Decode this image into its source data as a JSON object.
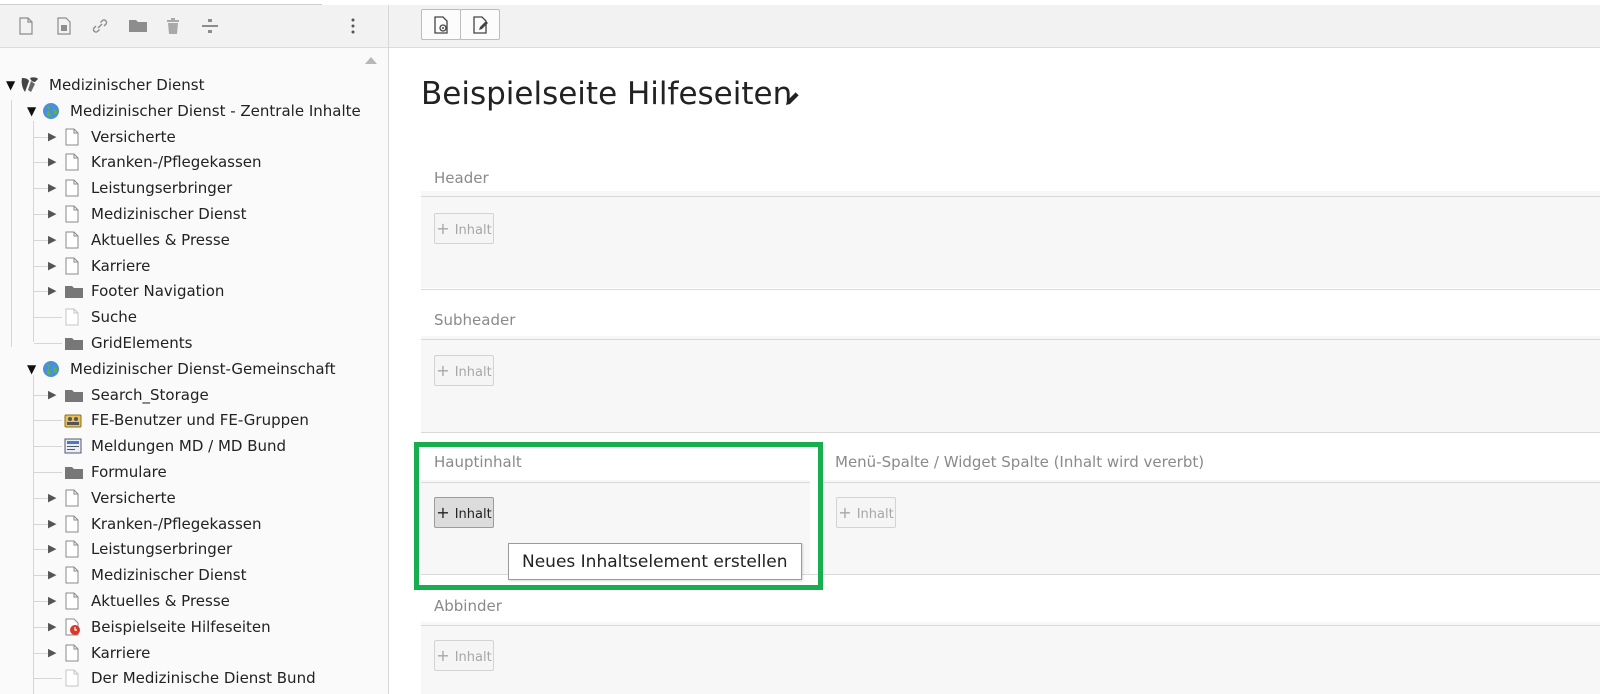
{
  "sidebar": {
    "toolbar": {
      "icons": [
        "new-page-icon",
        "new-page-inside-icon",
        "link-icon",
        "folder-icon",
        "trash-icon",
        "divider-icon",
        "more-icon"
      ]
    },
    "tree": [
      {
        "label": "Medizinischer Dienst",
        "level": 0,
        "icon": "typo3-logo",
        "expanded": true
      },
      {
        "label": "Medizinischer Dienst - Zentrale Inhalte",
        "level": 1,
        "icon": "globe",
        "expanded": true
      },
      {
        "label": "Versicherte",
        "level": 2,
        "icon": "page",
        "hasChildren": true
      },
      {
        "label": "Kranken-/Pflegekassen",
        "level": 2,
        "icon": "page",
        "hasChildren": true
      },
      {
        "label": "Leistungserbringer",
        "level": 2,
        "icon": "page",
        "hasChildren": true
      },
      {
        "label": "Medizinischer Dienst",
        "level": 2,
        "icon": "page",
        "hasChildren": true
      },
      {
        "label": "Aktuelles & Presse",
        "level": 2,
        "icon": "page",
        "hasChildren": true
      },
      {
        "label": "Karriere",
        "level": 2,
        "icon": "page",
        "hasChildren": true
      },
      {
        "label": "Footer Navigation",
        "level": 2,
        "icon": "folder",
        "hasChildren": true
      },
      {
        "label": "Suche",
        "level": 2,
        "icon": "page-light",
        "hasChildren": false
      },
      {
        "label": "GridElements",
        "level": 2,
        "icon": "folder",
        "hasChildren": false
      },
      {
        "label": "Medizinischer Dienst-Gemeinschaft",
        "level": 1,
        "icon": "globe",
        "expanded": true
      },
      {
        "label": "Search_Storage",
        "level": 2,
        "icon": "folder",
        "hasChildren": true
      },
      {
        "label": "FE-Benutzer und FE-Gruppen",
        "level": 2,
        "icon": "users",
        "hasChildren": false
      },
      {
        "label": "Meldungen MD / MD Bund",
        "level": 2,
        "icon": "news",
        "hasChildren": false
      },
      {
        "label": "Formulare",
        "level": 2,
        "icon": "folder",
        "hasChildren": false
      },
      {
        "label": "Versicherte",
        "level": 2,
        "icon": "page",
        "hasChildren": true
      },
      {
        "label": "Kranken-/Pflegekassen",
        "level": 2,
        "icon": "page",
        "hasChildren": true
      },
      {
        "label": "Leistungserbringer",
        "level": 2,
        "icon": "page",
        "hasChildren": true
      },
      {
        "label": "Medizinischer Dienst",
        "level": 2,
        "icon": "page",
        "hasChildren": true
      },
      {
        "label": "Aktuelles & Presse",
        "level": 2,
        "icon": "page",
        "hasChildren": true
      },
      {
        "label": "Beispielseite Hilfeseiten",
        "level": 2,
        "icon": "page-timer",
        "hasChildren": true
      },
      {
        "label": "Karriere",
        "level": 2,
        "icon": "page",
        "hasChildren": true
      },
      {
        "label": "Der Medizinische Dienst Bund",
        "level": 2,
        "icon": "page-light",
        "hasChildren": false
      }
    ]
  },
  "main": {
    "toolbar": {
      "buttons": [
        "view-page-icon",
        "edit-page-icon"
      ]
    },
    "title": "Beispielseite Hilfeseiten",
    "columns": {
      "header": {
        "title": "Header",
        "add_label": "Inhalt"
      },
      "subheader": {
        "title": "Subheader",
        "add_label": "Inhalt"
      },
      "hauptinhalt": {
        "title": "Hauptinhalt",
        "add_label": "Inhalt"
      },
      "menu": {
        "title": "Menü-Spalte / Widget Spalte (Inhalt wird vererbt)",
        "add_label": "Inhalt"
      },
      "abbinder": {
        "title": "Abbinder",
        "add_label": "Inhalt"
      }
    },
    "tooltip": "Neues Inhaltselement erstellen",
    "colors": {
      "highlight": "#18ad4f",
      "globe": "#4a90d9",
      "timer": "#d9382b"
    }
  }
}
